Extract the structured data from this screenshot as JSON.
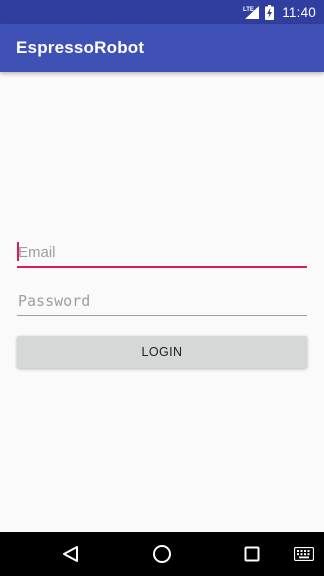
{
  "status_bar": {
    "time": "11:40",
    "network_label": "LTE",
    "background_color": "#303f9f"
  },
  "app_bar": {
    "title": "EspressoRobot",
    "background_color": "#3f51b5"
  },
  "form": {
    "email": {
      "value": "",
      "placeholder": "Email",
      "focused": true
    },
    "password": {
      "value": "",
      "placeholder": "Password"
    },
    "login_button": {
      "label": "LOGIN"
    }
  },
  "nav_bar": {
    "buttons": [
      "back-icon",
      "home-icon",
      "recents-icon",
      "keyboard-icon"
    ]
  },
  "colors": {
    "accent": "#d81b60",
    "primary": "#3f51b5",
    "primary_dark": "#303f9f"
  }
}
